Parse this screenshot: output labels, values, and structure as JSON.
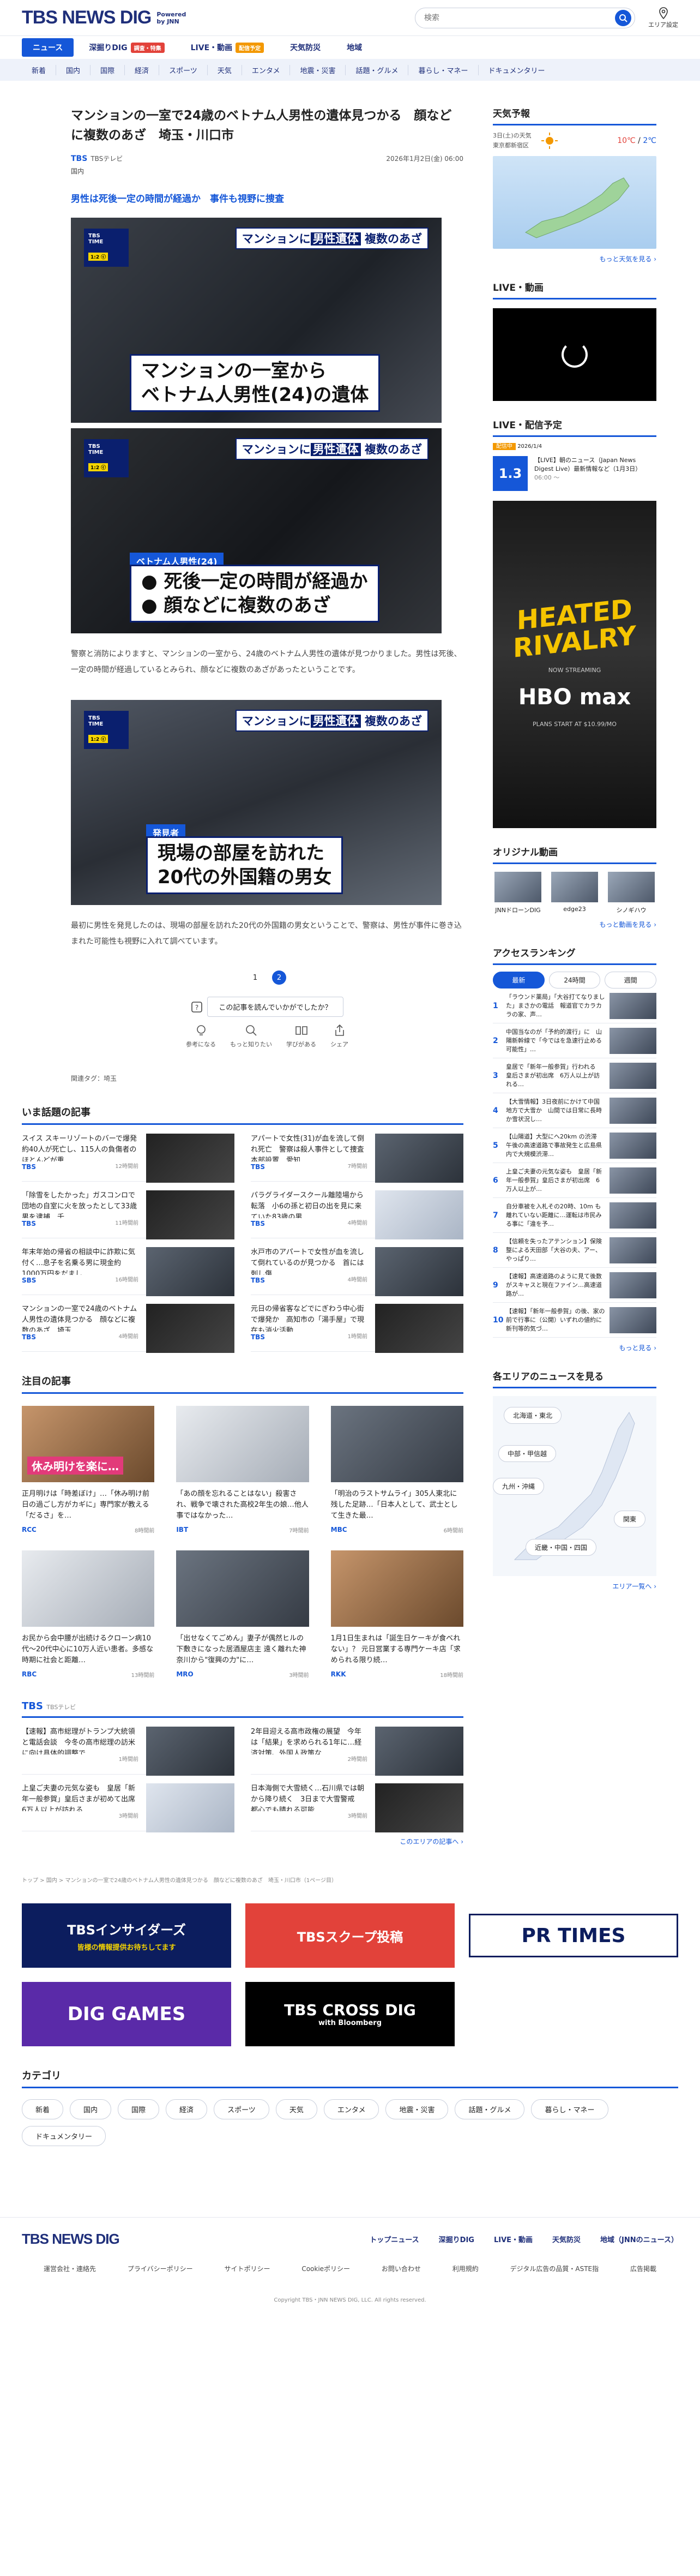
{
  "header": {
    "logo_main": "TBS NEWS DIG",
    "logo_powered": "Powered",
    "logo_by": "by JNN",
    "search_placeholder": "検索",
    "area_label": "エリア設定"
  },
  "nav": [
    {
      "label": "ニュース",
      "active": true,
      "badge": ""
    },
    {
      "label": "深掘りDIG",
      "active": false,
      "badge": "調査・特集"
    },
    {
      "label": "LIVE・動画",
      "active": false,
      "badge": "配信予定"
    },
    {
      "label": "天気防災",
      "active": false,
      "badge": ""
    },
    {
      "label": "地域",
      "active": false,
      "badge": ""
    }
  ],
  "categories": [
    "新着",
    "国内",
    "国際",
    "経済",
    "スポーツ",
    "天気",
    "エンタメ",
    "地震・災害",
    "話題・グルメ",
    "暮らし・マネー",
    "ドキュメンタリー"
  ],
  "article": {
    "title": "マンションの一室で24歳のベトナム人男性の遺体見つかる　顔などに複数のあざ　埼玉・川口市",
    "source_logo": "TBS",
    "source_name": "TBSテレビ",
    "date": "2026年1月2日(金) 06:00",
    "genre": "国内",
    "lead": "男性は死後一定の時間が経過か　事件も視野に捜査",
    "image1": {
      "caption_top_prefix": "マンションに",
      "caption_top_hl": "男性遺体",
      "caption_top_suffix": "複数のあざ",
      "caption_line1": "マンションの一室から",
      "caption_line2": "ベトナム人男性(24)の遺体",
      "mark_line1": "TBS",
      "mark_line2": "TIME",
      "mark_time": "1:2 ⓒ"
    },
    "image2": {
      "caption_top_prefix": "マンションに",
      "caption_top_hl": "男性遺体",
      "caption_top_suffix": "複数のあざ",
      "label": "ベトナム人男性(24)",
      "caption_line1": "● 死後一定の時間が経過か",
      "caption_line2": "● 顔などに複数のあざ",
      "mark_line1": "TBS",
      "mark_line2": "TIME",
      "mark_time": "1:2 ⓒ"
    },
    "paragraph1": "警察と消防によりますと、マンションの一室から、24歳のベトナム人男性の遺体が見つかりました。男性は死後、一定の時間が経過しているとみられ、顔などに複数のあざがあったということです。",
    "image3": {
      "caption_top_prefix": "マンションに",
      "caption_top_hl": "男性遺体",
      "caption_top_suffix": "複数のあざ",
      "label": "発見者",
      "caption_line1": "現場の部屋を訪れた",
      "caption_line2": "20代の外国籍の男女",
      "mark_line1": "TBS",
      "mark_line2": "TIME",
      "mark_time": "1:2 ⓒ"
    },
    "paragraph2": "最初に男性を発見したのは、現場の部屋を訪れた20代の外国籍の男女ということで、警察は、男性が事件に巻き込まれた可能性も視野に入れて調べています。",
    "pager": [
      "1",
      "2"
    ],
    "feedback_q": "この記事を読んでいかがでしたか？",
    "feedback_buttons": [
      "参考になる",
      "もっと知りたい",
      "学びがある",
      "シェア"
    ],
    "tags": "関連タグ：埼玉"
  },
  "trending": {
    "title": "いま話題の記事",
    "items": [
      {
        "text": "スイス スキーリゾートのバーで爆発 約40人が死亡し、115人の負傷者のほとんどが重…",
        "src": "TBS",
        "time": "12時間前"
      },
      {
        "text": "アパートで女性(31)が血を流して倒れ死亡　警察は殺人事件として捜査本部設置　愛知…",
        "src": "TBS",
        "time": "7時間前"
      },
      {
        "text": "「除雪をしたかった」ガスコンロで団地の自室に火を放ったとして33歳男を逮捕　千…",
        "src": "TBS",
        "time": "11時間前"
      },
      {
        "text": "パラグライダースクール離陸場から転落　小6の孫と初日の出を見に来ていた83歳の男…",
        "src": "TBS",
        "time": "4時間前"
      },
      {
        "text": "年末年始の帰省の相談中に詐欺に気付く…息子を名乗る男に現金約1000万円をだまし…",
        "src": "SBS",
        "time": "16時間前"
      },
      {
        "text": "水戸市のアパートで女性が血を流して倒れているのが見つかる　首には刺し傷",
        "src": "TBS",
        "time": "4時間前"
      },
      {
        "text": "マンションの一室で24歳のベトナム人男性の遺体見つかる　顔などに複数のあざ　埼玉…",
        "src": "TBS",
        "time": "4時間前"
      },
      {
        "text": "元日の帰省客などでにぎわう中心街で爆発か　高知市の「湯手屋」で現在も消火活動…",
        "src": "TBS",
        "time": "1時間前"
      }
    ]
  },
  "featured": {
    "title": "注目の記事",
    "items": [
      {
        "text": "正月明けは「時差ぼけ」…「休み明け前日の過ごし方がカギに」専門家が教える「だるさ」を…",
        "src": "RCC",
        "time": "8時間前",
        "overlay": "休み明けを楽に…"
      },
      {
        "text": "「あの顔を忘れることはない」殺害され、戦争で壊された高校2年生の娘…他人事ではなかった…",
        "src": "IBT",
        "time": "7時間前",
        "overlay": ""
      },
      {
        "text": "「明治のラストサムライ」305人東北に残した足跡…「日本人として、武士として生きた最…",
        "src": "MBC",
        "time": "6時間前",
        "overlay": ""
      },
      {
        "text": "お民から会中腰が出続けるクローン病10代〜20代中心に10万人近い患者。多感な時期に社会と距離…",
        "src": "RBC",
        "time": "13時間前",
        "overlay": ""
      },
      {
        "text": "「出せなくてごめん」妻子が偶然ヒルの下敷きになった居酒屋店主 遠く離れた神奈川から\"復興の力\"に…",
        "src": "MRO",
        "time": "3時間前",
        "overlay": ""
      },
      {
        "text": "1月1日生まれは「誕生日ケーキが食べれない」？ 元日営業する専門ケーキ店「求められる限り続…",
        "src": "RKK",
        "time": "18時間前",
        "overlay": ""
      }
    ]
  },
  "tbs_block": {
    "title": "TBS",
    "subtitle": "TBSテレビ",
    "items": [
      {
        "text": "【速報】高市総理がトランプ大統領と電話会談　今冬の高市総理の訪米に向け具体的調整で…",
        "src": "",
        "time": "1時間前"
      },
      {
        "text": "2年目迎える高市政権の展望　今年は「結果」を求められる1年に…経済対策、外国人政策な…",
        "src": "",
        "time": "2時間前"
      },
      {
        "text": "上皇ご夫妻の元気な姿も　皇居「新年一般参賀」皇后さまが初めて出席　6万人以上が訪れる…",
        "src": "",
        "time": "3時間前"
      },
      {
        "text": "日本海側で大雪続く…石川県では朝から降り続く　3日まで大雪警戒　都心でも晴れる可能…",
        "src": "",
        "time": "3時間前"
      }
    ],
    "more": "このエリアの記事へ ›"
  },
  "breadcrumb": "トップ > 国内 > マンションの一室で24歳のベトナム人男性の遺体見つかる　顔などに複数のあざ　埼玉・川口市（1ページ目）",
  "banners": {
    "insiders": "TBSインサイダーズ",
    "insiders_sub": "皆様の情報提供お待ちしてます",
    "scoop": "TBSスクープ投稿",
    "pr": "PR TIMES",
    "dig": "DIG GAMES",
    "cross": "TBS CROSS DIG",
    "cross_sub": "with Bloomberg"
  },
  "category_section": {
    "title": "カテゴリ",
    "items": [
      "新着",
      "国内",
      "国際",
      "経済",
      "スポーツ",
      "天気",
      "エンタメ",
      "地震・災害",
      "話題・グルメ",
      "暮らし・マネー",
      "ドキュメンタリー"
    ]
  },
  "footer": {
    "logo": "TBS NEWS DIG",
    "links": [
      "トップニュース",
      "深掘りDIG",
      "LIVE・動画",
      "天気防災",
      "地域（JNNのニュース）"
    ],
    "sub_links": [
      "運営会社・連絡先",
      "プライバシーポリシー",
      "サイトポリシー",
      "Cookieポリシー",
      "お問い合わせ",
      "利用規約",
      "デジタル広告の品質・ASTE指",
      "広告掲載"
    ],
    "copyright": "Copyright TBS・JNN NEWS DIG, LLC. All rights reserved."
  },
  "sidebar": {
    "weather": {
      "title": "天気予報",
      "date": "3日(土)の天気",
      "location": "東京都新宿区",
      "hi": "10℃",
      "lo": "2℃",
      "more": "もっと天気を見る ›"
    },
    "live": {
      "title": "LIVE・動画"
    },
    "schedule": {
      "title": "LIVE・配信予定",
      "badge": "配信中",
      "time": "2026/1/4",
      "day": "1.3",
      "text": "【LIVE】朝のニュース（Japan News Digest Live）最新情報など（1月3日）",
      "meta": "06:00 〜"
    },
    "ad": {
      "title_line1": "HEATED",
      "title_line2": "RIVALRY",
      "streaming": "NOW STREAMING",
      "brand": "HBO max",
      "cta": "PLANS START AT $10.99/MO"
    },
    "original": {
      "title": "オリジナル動画",
      "items": [
        "JNNドローンDIG",
        "edge23",
        "シノギハウ"
      ],
      "more": "もっと動画を見る ›"
    },
    "ranking": {
      "title": "アクセスランキング",
      "tabs": [
        "最新",
        "24時間",
        "週間"
      ],
      "items": [
        "「ラウンド薬局」「大谷打てなりました」まさかの電話　報道官でカラカラの家、声…",
        "中国当なのが「予約的渡行」に　山陽新幹線で「今ではを急速行止める可能性」…",
        "皇居で「新年一般参賀」行われる　皇后さまが初出席　6万人以上が訪れる…",
        "【大雪情報】3日夜前にかけて中国地方で大雪か　山間では日常に長時か雪状況し…",
        "【山陽道】大型にへ20km の渋滞　午後の高速道路で事故発生と広島県内で大規模渋滞…",
        "上皇ご夫妻の元気な姿も　皇居「新年一般参賀」皇后さまが初出席　6万人以上が…",
        "自分車被を入札その20時、10m も離れていない距離に…運転は市民みる事に「違を予…",
        "【信頼を失ったアテンション】保険整による天田部「大谷の夫、アー、やっぱり…",
        "【速報】高速道路のように見て後数がスキャスと現在ファイン…高速道路が…",
        "【速報】「新年一般参賀」の後、家の前で行事に（公開）いずれの値約に新刊等的気づ…"
      ],
      "more": "もっと見る ›"
    },
    "area": {
      "title": "各エリアのニュースを見る",
      "regions": [
        "北海道・東北",
        "中部・甲信越",
        "九州・沖縄",
        "関東",
        "近畿・中国・四国"
      ],
      "more": "エリア一覧へ ›"
    }
  }
}
